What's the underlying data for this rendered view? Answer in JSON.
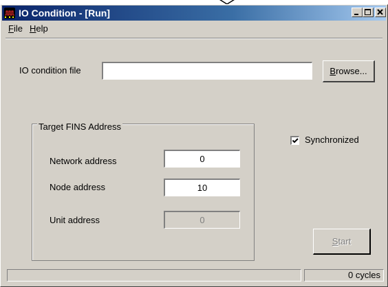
{
  "window": {
    "title": "IO Condition - [Run]",
    "app_icon": "pulse-waveform-icon",
    "controls": {
      "minimize": "_",
      "maximize": "□",
      "close": "X"
    }
  },
  "menu": {
    "file_accel": "F",
    "file_rest": "ile",
    "help_accel": "H",
    "help_rest": "elp"
  },
  "io_file": {
    "label": "IO condition file",
    "value": "",
    "browse_accel": "B",
    "browse_rest": "rowse..."
  },
  "fins": {
    "group_title": "Target FINS Address",
    "network_label": "Network address",
    "network_value": "0",
    "node_label": "Node address",
    "node_value": "10",
    "unit_label": "Unit address",
    "unit_value": "0"
  },
  "sync": {
    "label": "Synchronized",
    "checked": true
  },
  "start": {
    "accel": "S",
    "rest": "tart",
    "enabled": false
  },
  "status": {
    "main": "",
    "cycles": "0 cycles"
  },
  "colors": {
    "face": "#d4d0c8",
    "title_start": "#0a246a",
    "title_end": "#a6caf0",
    "disabled_text": "#808080"
  }
}
